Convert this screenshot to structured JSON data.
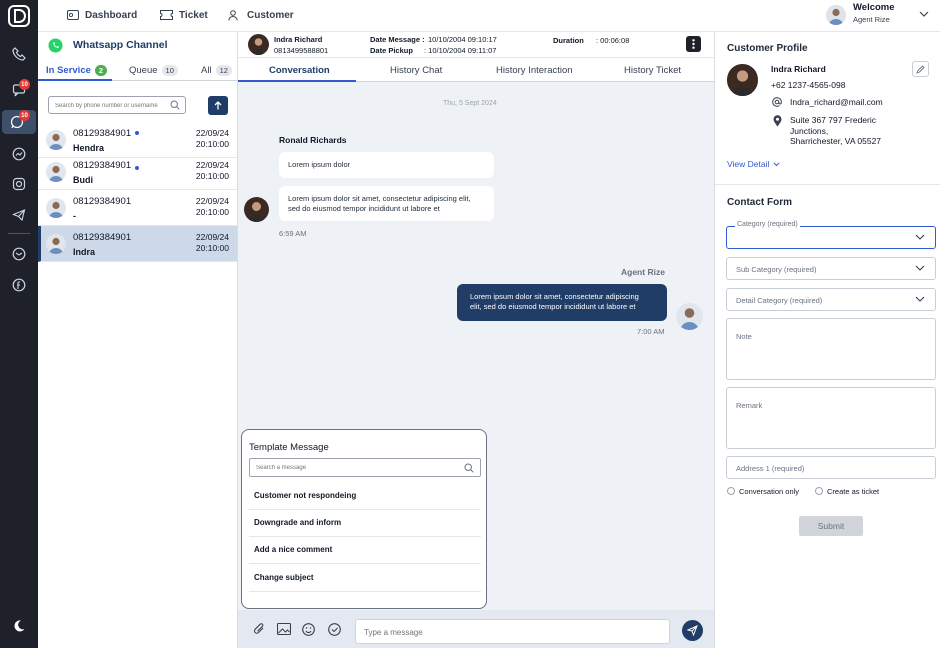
{
  "nav": {
    "dashboard": "Dashboard",
    "ticket": "Ticket",
    "customer": "Customer",
    "welcome": "Welcome",
    "agent_name": "Agent Rize"
  },
  "rail": {
    "badges": [
      "10",
      "10"
    ]
  },
  "channel": {
    "title": "Whatsapp Channel",
    "tabs": [
      {
        "label": "In Service",
        "count": "2"
      },
      {
        "label": "Queue",
        "count": "10"
      },
      {
        "label": "All",
        "count": "12"
      }
    ],
    "search_placeholder": "Search by phone number or username",
    "conversations": [
      {
        "phone": "08129384901",
        "name": "Hendra",
        "date": "22/09/24",
        "time": "20:10:00"
      },
      {
        "phone": "08129384901",
        "name": "Budi",
        "date": "22/09/24",
        "time": "20:10:00"
      },
      {
        "phone": "08129384901",
        "name": "-",
        "date": "22/09/24",
        "time": "20:10:00"
      },
      {
        "phone": "08129384901",
        "name": "Indra",
        "date": "22/09/24",
        "time": "20:10:00"
      }
    ]
  },
  "chat": {
    "header": {
      "name": "Indra Richard",
      "phone": "0813499588801",
      "date_message_label": "Date Message :",
      "date_message": "10/10/2004 09:10:17",
      "date_pickup_label": "Date Pickup",
      "date_pickup": ": 10/10/2004 09:11:07",
      "duration_label": "Duration",
      "duration": ": 00:06:08"
    },
    "tabs": [
      "Conversation",
      "History Chat",
      "History Interaction",
      "History Ticket"
    ],
    "date_divider": "Thu, 5 Sept 2024",
    "incoming": {
      "sender": "Ronald Richards",
      "msg1": "Lorem ipsum dolor",
      "msg2_line1": "Lorem ipsum dolor sit amet, consectetur adipiscing elit,",
      "msg2_line2": "sed do eiusmod tempor incididunt ut labore et",
      "time": "6:59 AM"
    },
    "outgoing": {
      "sender": "Agent Rize",
      "line1": "Lorem ipsum dolor sit amet, consectetur adipiscing",
      "line2": "elit, sed do eiusmod tempor incididunt ut labore et",
      "time": "7:00 AM"
    },
    "template": {
      "title": "Template Message",
      "search_placeholder": "Search a message",
      "items": [
        "Customer not respondeing",
        "Downgrade and inform",
        "Add a nice comment",
        "Change subject"
      ]
    },
    "composer_placeholder": "Type a message"
  },
  "profile": {
    "title": "Customer Profile",
    "name": "Indra Richard",
    "phone": "+62 1237-4565-098",
    "email": "Indra_richard@mail.com",
    "address_line1": "Suite 367 797 Frederic",
    "address_line2": "Junctions,",
    "address_line3": "Sharrichester, VA 05527",
    "view_detail": "View Detail"
  },
  "contact_form": {
    "title": "Contact Form",
    "category": "Category (required)",
    "sub_category": "Sub Category (required)",
    "detail_category": "Detail Category (required)",
    "note": "Note",
    "remark": "Remark",
    "address": "Address 1 (required)",
    "radio1": "Conversation only",
    "radio2": "Create as ticket",
    "submit": "Submit"
  },
  "colors": {
    "rail": "#1e2129",
    "accent": "#2f5bd3",
    "navy": "#1f3d66",
    "whatsapp": "#25d366"
  }
}
